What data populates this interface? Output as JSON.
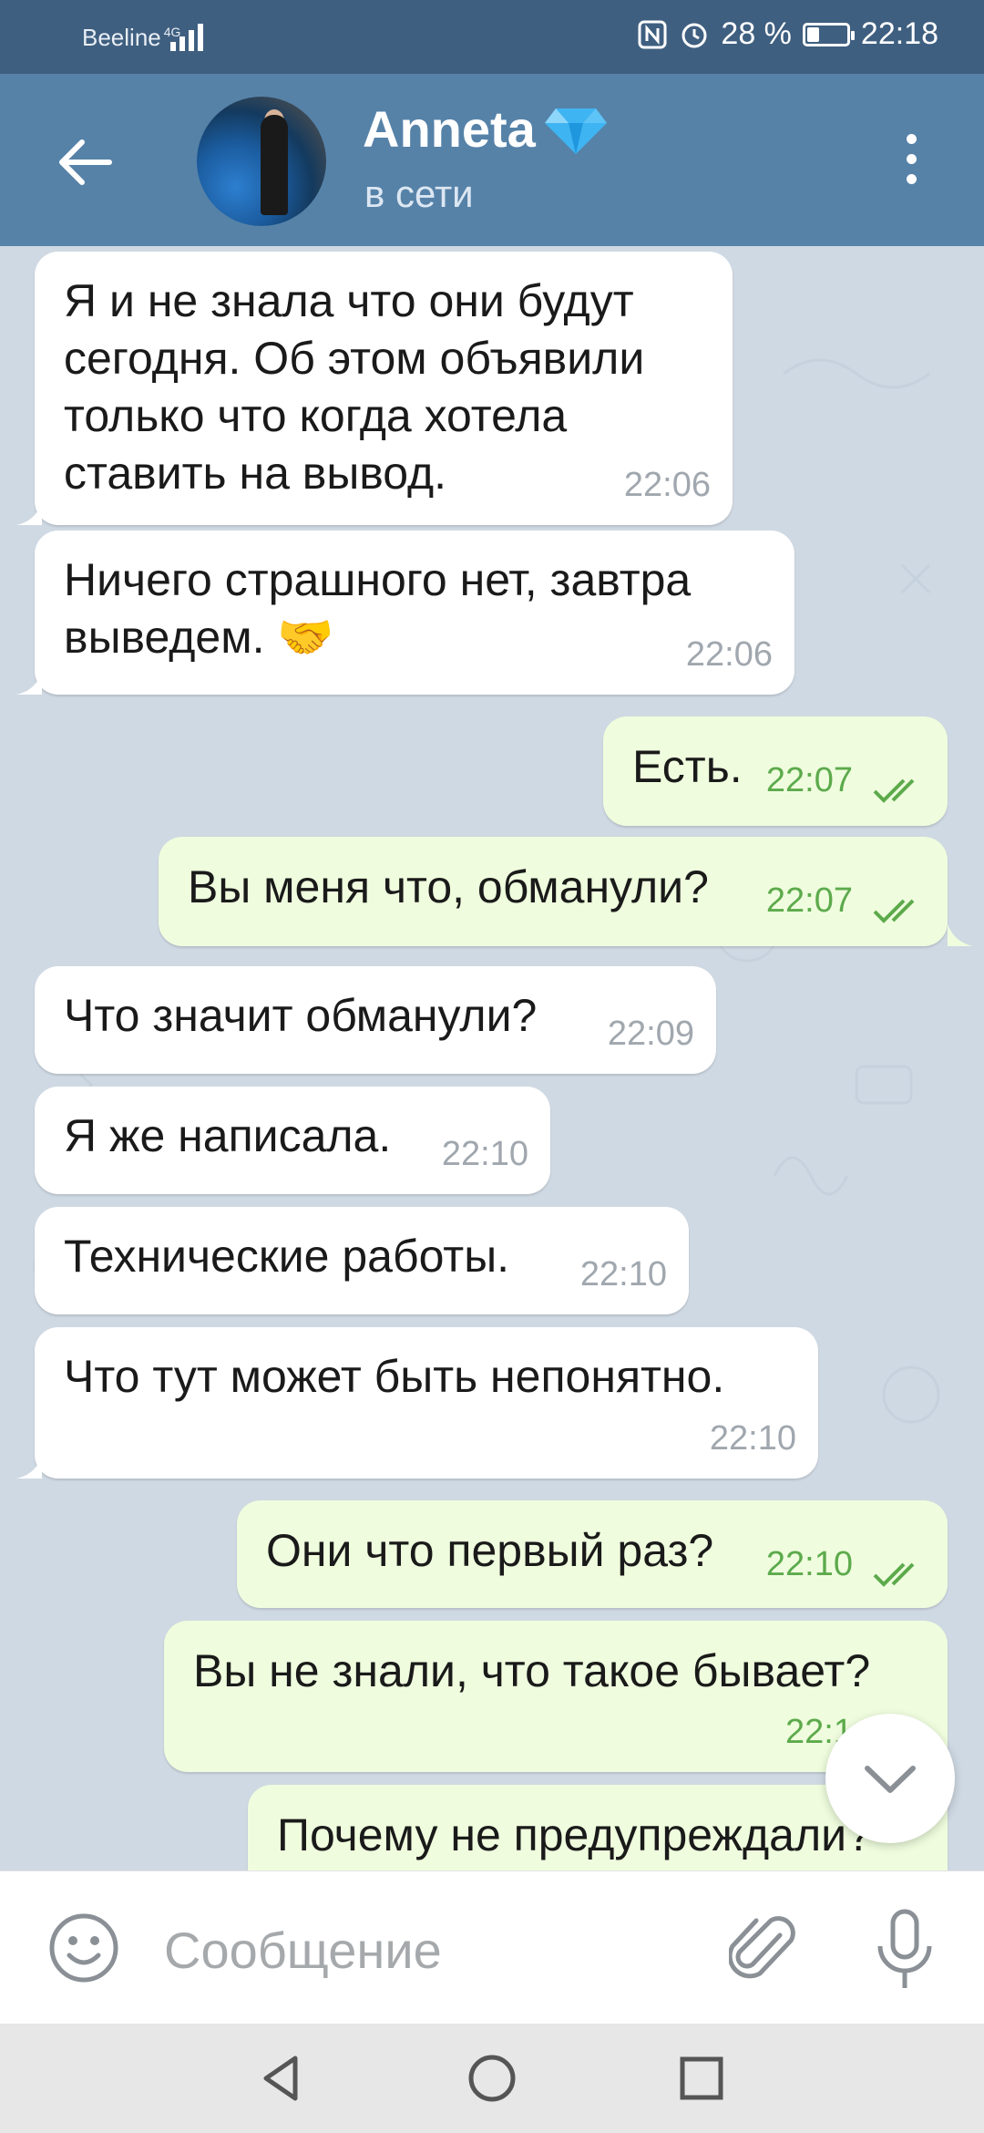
{
  "status_bar": {
    "carrier": "Beeline",
    "network": "4G",
    "battery": "28 %",
    "time": "22:18"
  },
  "header": {
    "contact_name": "Anneta",
    "contact_status": "в сети"
  },
  "messages": [
    {
      "dir": "in",
      "text": "Я и не знала что они будут\nсегодня. Об этом объявили\nтолько что когда хотела\nставить на вывод.",
      "time": "22:06"
    },
    {
      "dir": "in",
      "text": "Ничего страшного нет, завтра\nвыведем. 🤝",
      "time": "22:06"
    },
    {
      "dir": "out",
      "text": "Есть.",
      "time": "22:07",
      "read": true
    },
    {
      "dir": "out",
      "text": "Вы меня что, обманули?",
      "time": "22:07",
      "read": true
    },
    {
      "dir": "in",
      "text": "Что значит обманули?",
      "time": "22:09"
    },
    {
      "dir": "in",
      "text": "Я же написала.",
      "time": "22:10"
    },
    {
      "dir": "in",
      "text": "Технические работы.",
      "time": "22:10"
    },
    {
      "dir": "in",
      "text": "Что тут может быть непонятно.",
      "time": "22:10"
    },
    {
      "dir": "out",
      "text": "Они что первый раз?",
      "time": "22:10",
      "read": true
    },
    {
      "dir": "out",
      "text": "Вы не знали, что такое бывает?",
      "time": "22:1",
      "read": true
    },
    {
      "dir": "out",
      "text": "Почему не предупреждали?",
      "time": "",
      "read": true
    }
  ],
  "input": {
    "placeholder": "Сообщение"
  },
  "icons": {
    "back": "arrow-left-icon",
    "more": "more-vertical-icon",
    "emoji": "smile-icon",
    "attach": "paperclip-icon",
    "mic": "microphone-icon",
    "scroll_down": "chevron-down-icon"
  },
  "colors": {
    "status_bar": "#3f5f80",
    "header": "#5682a8",
    "chat_background": "#cfd9e3",
    "incoming_bubble": "#ffffff",
    "outgoing_bubble": "#effdde",
    "outgoing_time": "#5daa4c"
  }
}
